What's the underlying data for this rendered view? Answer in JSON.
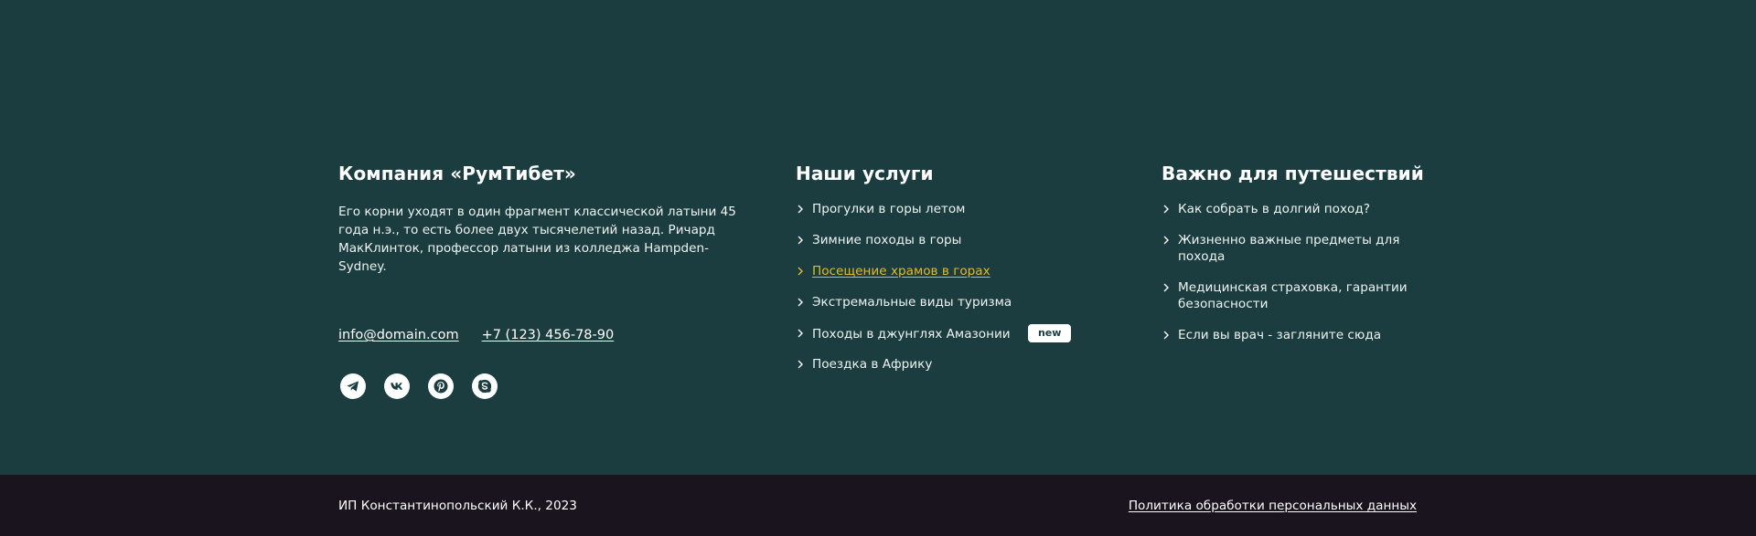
{
  "company": {
    "title": "Компания «РумТибет»",
    "about": "Его корни уходят в один фрагмент классической латыни 45 года н.э., то есть более двух тысячелетий назад. Ричард МакКлинток, профессор латыни из колледжа Hampden-Sydney.",
    "email": "info@domain.com",
    "phone": "+7 (123) 456-78-90",
    "socials": [
      "telegram-icon",
      "vk-icon",
      "pinterest-icon",
      "skype-icon"
    ]
  },
  "services": {
    "title": "Наши услуги",
    "items": [
      {
        "label": "Прогулки в горы летом"
      },
      {
        "label": "Зимние походы в горы"
      },
      {
        "label": "Посещение храмов в горах",
        "active": true
      },
      {
        "label": "Экстремальные виды туризма"
      },
      {
        "label": "Походы в джунглях Амазонии",
        "badge": "new"
      },
      {
        "label": "Поездка в Африку"
      }
    ]
  },
  "important": {
    "title": "Важно для путешествий",
    "items": [
      {
        "label": "Как собрать в долгий поход?"
      },
      {
        "label": "Жизненно важные предметы для похода"
      },
      {
        "label": "Медицинская страховка, гарантии безопасности"
      },
      {
        "label": "Если вы врач - загляните сюда"
      }
    ]
  },
  "bottom": {
    "copyright": "ИП Константинопольский К.К., 2023",
    "privacy": "Политика обработки персональных данных"
  },
  "colors": {
    "footer_bg": "#1b3d3f",
    "bottom_bg": "#1a141f",
    "accent": "#e3b92e"
  }
}
